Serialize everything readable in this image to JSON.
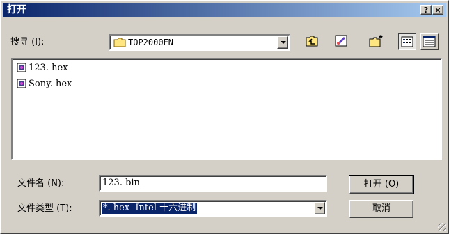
{
  "dialog": {
    "title": "打开",
    "help_btn": "?",
    "close_btn": "×"
  },
  "lookin": {
    "label": "搜寻 (I):",
    "value": "TOP2000EN",
    "folder_icon": "folder-icon"
  },
  "toolbar": {
    "items": [
      {
        "name": "up-one-level-icon"
      },
      {
        "name": "desktop-icon"
      },
      {
        "name": "new-folder-icon"
      },
      {
        "name": "list-view-icon"
      },
      {
        "name": "details-view-icon"
      }
    ]
  },
  "files": [
    {
      "name": "123. hex",
      "icon": "hex-file-icon"
    },
    {
      "name": "Sony. hex",
      "icon": "hex-file-icon"
    }
  ],
  "filename": {
    "label": "文件名 (N):",
    "value": "123. bin"
  },
  "filetype": {
    "label": "文件类型 (T):",
    "value": "*. hex  Intel 十六进制"
  },
  "buttons": {
    "open": "打开 (O)",
    "cancel": "取消"
  },
  "colors": {
    "title_start": "#0a246a",
    "title_end": "#a6caf0",
    "face": "#d4d0c8",
    "selection": "#0a246a"
  }
}
